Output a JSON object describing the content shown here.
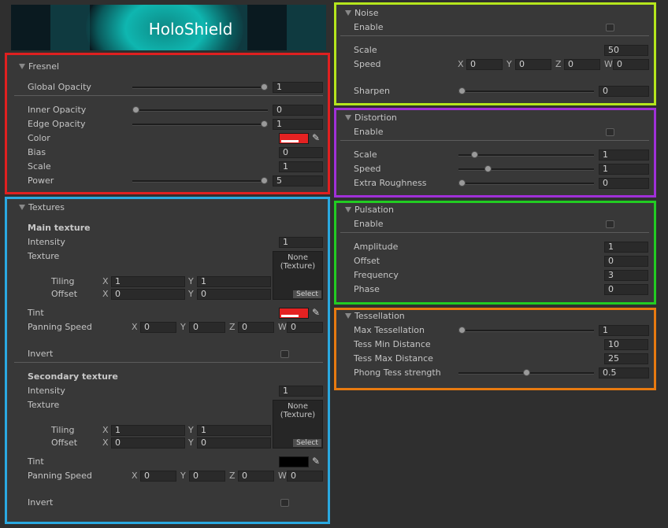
{
  "banner": {
    "title": "HoloShield"
  },
  "colors": {
    "fresnel_frame": "#e02020",
    "textures_frame": "#2aa8e0",
    "noise_frame": "#b5e61d",
    "distortion_frame": "#a030d8",
    "pulsation_frame": "#22cc22",
    "tessellation_frame": "#e87a10",
    "color_swatch": "#e52222",
    "main_tint": "#e52222",
    "secondary_tint": "#000000"
  },
  "fresnel": {
    "title": "Fresnel",
    "global_opacity": {
      "label": "Global Opacity",
      "value": "1",
      "level": 1
    },
    "inner_opacity": {
      "label": "Inner Opacity",
      "value": "0",
      "level": 0
    },
    "edge_opacity": {
      "label": "Edge Opacity",
      "value": "1",
      "level": 1
    },
    "color": {
      "label": "Color"
    },
    "bias": {
      "label": "Bias",
      "value": "0"
    },
    "scale": {
      "label": "Scale",
      "value": "1"
    },
    "power": {
      "label": "Power",
      "value": "5",
      "level": 1
    }
  },
  "textures": {
    "title": "Textures",
    "axis": {
      "x": "X",
      "y": "Y",
      "z": "Z",
      "w": "W"
    },
    "main": {
      "heading": "Main texture",
      "intensity": {
        "label": "Intensity",
        "value": "1"
      },
      "texture": {
        "label": "Texture",
        "none": "None",
        "type": "(Texture)",
        "select": "Select"
      },
      "tiling": {
        "label": "Tiling",
        "x": "1",
        "y": "1"
      },
      "offset": {
        "label": "Offset",
        "x": "0",
        "y": "0"
      },
      "tint": {
        "label": "Tint"
      },
      "panning": {
        "label": "Panning Speed",
        "x": "0",
        "y": "0",
        "z": "0",
        "w": "0"
      },
      "invert": {
        "label": "Invert"
      }
    },
    "secondary": {
      "heading": "Secondary texture",
      "intensity": {
        "label": "Intensity",
        "value": "1"
      },
      "texture": {
        "label": "Texture",
        "none": "None",
        "type": "(Texture)",
        "select": "Select"
      },
      "tiling": {
        "label": "Tiling",
        "x": "1",
        "y": "1"
      },
      "offset": {
        "label": "Offset",
        "x": "0",
        "y": "0"
      },
      "tint": {
        "label": "Tint"
      },
      "panning": {
        "label": "Panning Speed",
        "x": "0",
        "y": "0",
        "z": "0",
        "w": "0"
      },
      "invert": {
        "label": "Invert"
      }
    }
  },
  "noise": {
    "title": "Noise",
    "enable": {
      "label": "Enable"
    },
    "scale": {
      "label": "Scale",
      "value": "50"
    },
    "speed": {
      "label": "Speed",
      "x": "0",
      "y": "0",
      "z": "0",
      "w": "0"
    },
    "sharpen": {
      "label": "Sharpen",
      "value": "0",
      "level": 0
    }
  },
  "distortion": {
    "title": "Distortion",
    "enable": {
      "label": "Enable"
    },
    "scale": {
      "label": "Scale",
      "value": "1",
      "level": 0.1
    },
    "speed": {
      "label": "Speed",
      "value": "1",
      "level": 0.2
    },
    "extra_roughness": {
      "label": "Extra Roughness",
      "value": "0",
      "level": 0
    }
  },
  "pulsation": {
    "title": "Pulsation",
    "enable": {
      "label": "Enable"
    },
    "amplitude": {
      "label": "Amplitude",
      "value": "1"
    },
    "offset": {
      "label": "Offset",
      "value": "0"
    },
    "frequency": {
      "label": "Frequency",
      "value": "3"
    },
    "phase": {
      "label": "Phase",
      "value": "0"
    }
  },
  "tessellation": {
    "title": "Tessellation",
    "max_tessellation": {
      "label": "Max Tessellation",
      "value": "1",
      "level": 0
    },
    "tess_min_distance": {
      "label": "Tess Min Distance",
      "value": "10"
    },
    "tess_max_distance": {
      "label": "Tess Max Distance",
      "value": "25"
    },
    "phong_tess_strength": {
      "label": "Phong Tess strength",
      "value": "0.5",
      "level": 0.5
    }
  }
}
